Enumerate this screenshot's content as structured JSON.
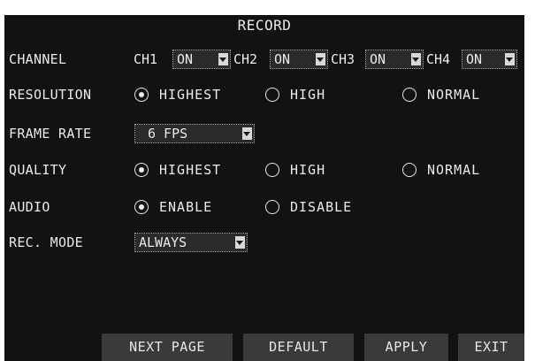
{
  "title": "RECORD",
  "channel": {
    "label": "CHANNEL",
    "channels": [
      {
        "name": "CH1",
        "value": "ON"
      },
      {
        "name": "CH2",
        "value": "ON"
      },
      {
        "name": "CH3",
        "value": "ON"
      },
      {
        "name": "CH4",
        "value": "ON"
      }
    ]
  },
  "resolution": {
    "label": "RESOLUTION",
    "options": [
      "HIGHEST",
      "HIGH",
      "NORMAL"
    ],
    "selected": "HIGHEST"
  },
  "frame_rate": {
    "label": "FRAME RATE",
    "value": "6 FPS"
  },
  "quality": {
    "label": "QUALITY",
    "options": [
      "HIGHEST",
      "HIGH",
      "NORMAL"
    ],
    "selected": "HIGHEST"
  },
  "audio": {
    "label": "AUDIO",
    "options": [
      "ENABLE",
      "DISABLE"
    ],
    "selected": "ENABLE"
  },
  "rec_mode": {
    "label": "REC. MODE",
    "value": "ALWAYS"
  },
  "buttons": {
    "next_page": "NEXT PAGE",
    "default": "DEFAULT",
    "apply": "APPLY",
    "exit": "EXIT"
  },
  "colors": {
    "panel_bg": "#121212",
    "text": "#eaeaea",
    "button_bg": "#3a3a3a"
  }
}
